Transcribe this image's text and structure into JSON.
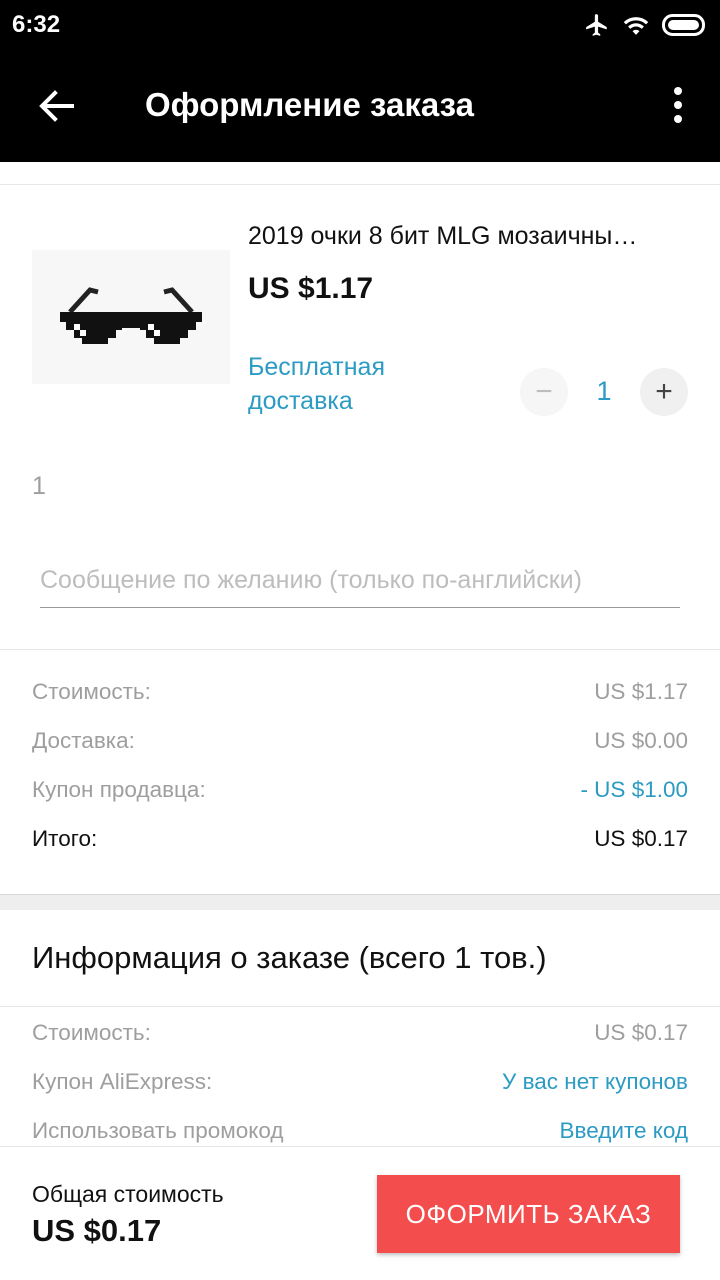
{
  "status_bar": {
    "time": "6:32",
    "icons": [
      "airplane-icon",
      "wifi-icon",
      "battery-icon"
    ]
  },
  "app_bar": {
    "title": "Оформление заказа",
    "back_icon": "arrow-left-icon",
    "menu_icon": "more-vert-icon"
  },
  "product": {
    "title": "2019 очки 8 бит MLG мозаичны…",
    "price": "US $1.17",
    "shipping": "Бесплатная доставка",
    "quantity": "1",
    "minus_icon": "−",
    "plus_icon": "+",
    "count_note": "1"
  },
  "message": {
    "placeholder": "Сообщение по желанию (только по-английски)"
  },
  "summary": {
    "rows": [
      {
        "label": "Стоимость:",
        "value": "US $1.17"
      },
      {
        "label": "Доставка:",
        "value": "US $0.00"
      },
      {
        "label": "Купон продавца:",
        "value": "- US $1.00"
      },
      {
        "label": "Итого:",
        "value": "US $0.17"
      }
    ]
  },
  "order_info": {
    "title": "Информация о заказе (всего 1 тов.)",
    "rows": [
      {
        "label": "Стоимость:",
        "value": "US $0.17"
      },
      {
        "label": "Купон AliExpress:",
        "value": "У вас нет купонов"
      },
      {
        "label": "Использовать промокод",
        "value": "Введите код"
      }
    ]
  },
  "footer": {
    "total_label": "Общая стоимость",
    "total_value": "US $0.17",
    "checkout_label": "ОФОРМИТЬ ЗАКАЗ"
  },
  "colors": {
    "accent_blue": "#2b9bc4",
    "checkout_red": "#f44d4d",
    "app_bar": "#000000"
  }
}
